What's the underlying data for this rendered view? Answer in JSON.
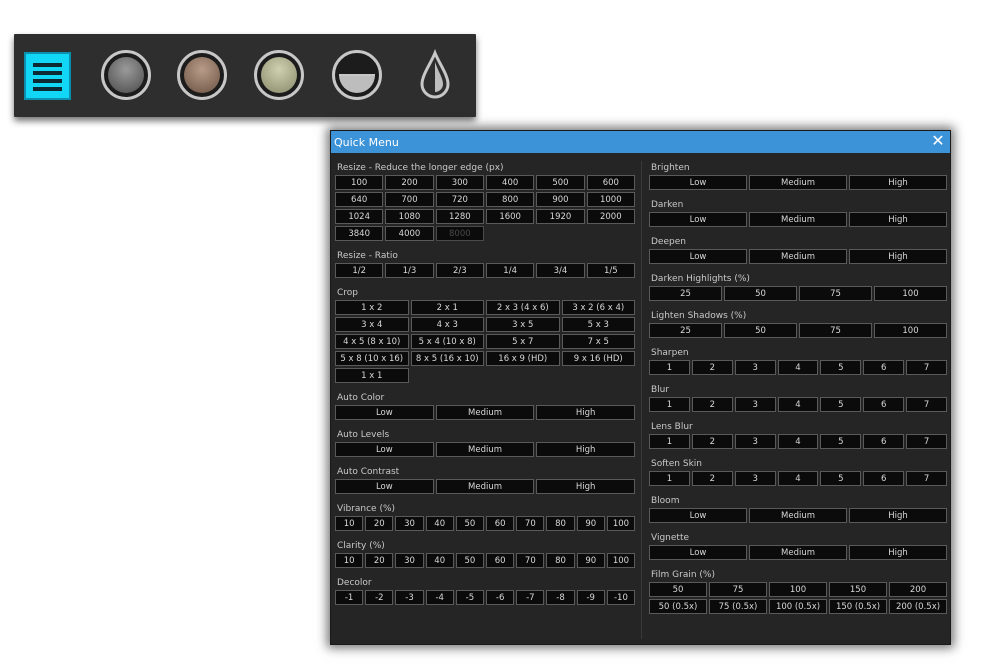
{
  "toolbar": {
    "icons": [
      "menu-icon",
      "gray-circle-icon",
      "brown-circle-icon",
      "olive-circle-icon",
      "half-circle-icon",
      "drop-icon"
    ],
    "colors": {
      "menu_bg": "#12d6f5",
      "gray": "#6a6a6a",
      "brown": "#8c7160",
      "olive": "#a9aa8a"
    }
  },
  "dialog": {
    "title": "Quick Menu",
    "close_glyph": "✕",
    "titlebar_color": "#3c93d8"
  },
  "left": [
    {
      "title": "Resize - Reduce the longer edge (px)",
      "cols": 6,
      "rows": [
        [
          "100",
          "200",
          "300",
          "400",
          "500",
          "600"
        ],
        [
          "640",
          "700",
          "720",
          "800",
          "900",
          "1000"
        ],
        [
          "1024",
          "1080",
          "1280",
          "1600",
          "1920",
          "2000"
        ],
        [
          "3840",
          "4000",
          "8000"
        ]
      ],
      "disabled": [
        "8000"
      ]
    },
    {
      "title": "Resize - Ratio",
      "cols": 6,
      "rows": [
        [
          "1/2",
          "1/3",
          "2/3",
          "1/4",
          "3/4",
          "1/5"
        ]
      ]
    },
    {
      "title": "Crop",
      "cols": 4,
      "rows": [
        [
          "1 x 2",
          "2 x 1",
          "2 x 3 (4 x 6)",
          "3 x 2 (6 x 4)"
        ],
        [
          "3 x 4",
          "4 x 3",
          "3 x 5",
          "5 x 3"
        ],
        [
          "4 x 5 (8 x 10)",
          "5 x 4 (10 x 8)",
          "5 x 7",
          "7 x 5"
        ],
        [
          "5 x 8 (10 x 16)",
          "8 x 5 (16 x 10)",
          "16 x 9 (HD)",
          "9 x 16 (HD)"
        ],
        [
          "1 x 1"
        ]
      ]
    },
    {
      "title": "Auto Color",
      "cols": 3,
      "rows": [
        [
          "Low",
          "Medium",
          "High"
        ]
      ]
    },
    {
      "title": "Auto Levels",
      "cols": 3,
      "rows": [
        [
          "Low",
          "Medium",
          "High"
        ]
      ]
    },
    {
      "title": "Auto Contrast",
      "cols": 3,
      "rows": [
        [
          "Low",
          "Medium",
          "High"
        ]
      ]
    },
    {
      "title": "Vibrance (%)",
      "cols": 10,
      "rows": [
        [
          "10",
          "20",
          "30",
          "40",
          "50",
          "60",
          "70",
          "80",
          "90",
          "100"
        ]
      ]
    },
    {
      "title": "Clarity (%)",
      "cols": 10,
      "rows": [
        [
          "10",
          "20",
          "30",
          "40",
          "50",
          "60",
          "70",
          "80",
          "90",
          "100"
        ]
      ]
    },
    {
      "title": "Decolor",
      "cols": 10,
      "rows": [
        [
          "-1",
          "-2",
          "-3",
          "-4",
          "-5",
          "-6",
          "-7",
          "-8",
          "-9",
          "-10"
        ]
      ]
    }
  ],
  "right": [
    {
      "title": "Brighten",
      "cols": 3,
      "rows": [
        [
          "Low",
          "Medium",
          "High"
        ]
      ]
    },
    {
      "title": "Darken",
      "cols": 3,
      "rows": [
        [
          "Low",
          "Medium",
          "High"
        ]
      ]
    },
    {
      "title": "Deepen",
      "cols": 3,
      "rows": [
        [
          "Low",
          "Medium",
          "High"
        ]
      ]
    },
    {
      "title": "Darken Highlights (%)",
      "cols": 4,
      "rows": [
        [
          "25",
          "50",
          "75",
          "100"
        ]
      ]
    },
    {
      "title": "Lighten Shadows (%)",
      "cols": 4,
      "rows": [
        [
          "25",
          "50",
          "75",
          "100"
        ]
      ]
    },
    {
      "title": "Sharpen",
      "cols": 7,
      "rows": [
        [
          "1",
          "2",
          "3",
          "4",
          "5",
          "6",
          "7"
        ]
      ]
    },
    {
      "title": "Blur",
      "cols": 7,
      "rows": [
        [
          "1",
          "2",
          "3",
          "4",
          "5",
          "6",
          "7"
        ]
      ]
    },
    {
      "title": "Lens Blur",
      "cols": 7,
      "rows": [
        [
          "1",
          "2",
          "3",
          "4",
          "5",
          "6",
          "7"
        ]
      ]
    },
    {
      "title": "Soften Skin",
      "cols": 7,
      "rows": [
        [
          "1",
          "2",
          "3",
          "4",
          "5",
          "6",
          "7"
        ]
      ]
    },
    {
      "title": "Bloom",
      "cols": 3,
      "rows": [
        [
          "Low",
          "Medium",
          "High"
        ]
      ]
    },
    {
      "title": "Vignette",
      "cols": 3,
      "rows": [
        [
          "Low",
          "Medium",
          "High"
        ]
      ]
    },
    {
      "title": "Film Grain (%)",
      "cols": 5,
      "rows": [
        [
          "50",
          "75",
          "100",
          "150",
          "200"
        ],
        [
          "50 (0.5x)",
          "75 (0.5x)",
          "100 (0.5x)",
          "150 (0.5x)",
          "200 (0.5x)"
        ]
      ]
    }
  ]
}
